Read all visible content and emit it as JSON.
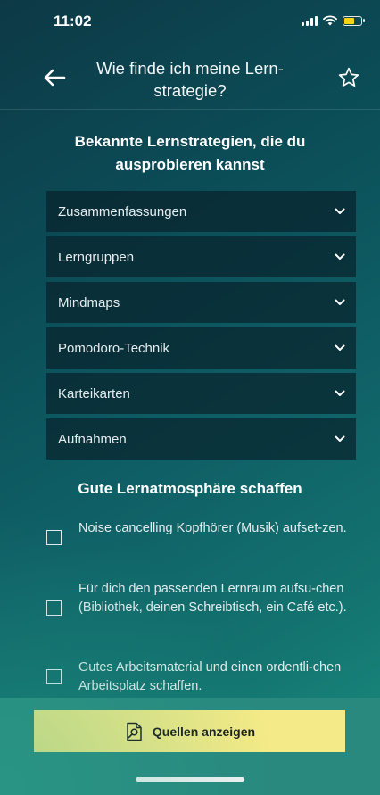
{
  "status_bar": {
    "time": "11:02"
  },
  "header": {
    "title": "Wie finde ich meine Lern-strategie?"
  },
  "strategies": {
    "heading": "Bekannte Lernstrategien, die du ausprobieren kannst",
    "items": [
      {
        "label": "Zusammenfassungen"
      },
      {
        "label": "Lerngruppen"
      },
      {
        "label": "Mindmaps"
      },
      {
        "label": "Pomodoro-Technik"
      },
      {
        "label": "Karteikarten"
      },
      {
        "label": "Aufnahmen"
      }
    ]
  },
  "atmosphere": {
    "heading": "Gute Lernatmosphäre schaffen",
    "items": [
      {
        "text": "Noise cancelling Kopfhörer (Musik) aufset-zen.",
        "checked": false
      },
      {
        "text": "Für dich den passenden Lernraum aufsu-chen (Bibliothek, deinen Schreibtisch, ein Café etc.).",
        "checked": false
      },
      {
        "text": "Gutes Arbeitsmaterial und einen ordentli-chen Arbeitsplatz schaffen.",
        "checked": false
      }
    ]
  },
  "footer": {
    "sources_button": "Quellen anzeigen"
  },
  "icons": {
    "back": "arrow-left-icon",
    "favorite": "star-outline-icon",
    "expand": "chevron-down-icon",
    "sources": "document-search-icon"
  },
  "colors": {
    "button_bg": "#f4ea87",
    "bottom_bar": "#29897f",
    "accordion_bg": "#08232d",
    "battery": "#f7d317"
  }
}
